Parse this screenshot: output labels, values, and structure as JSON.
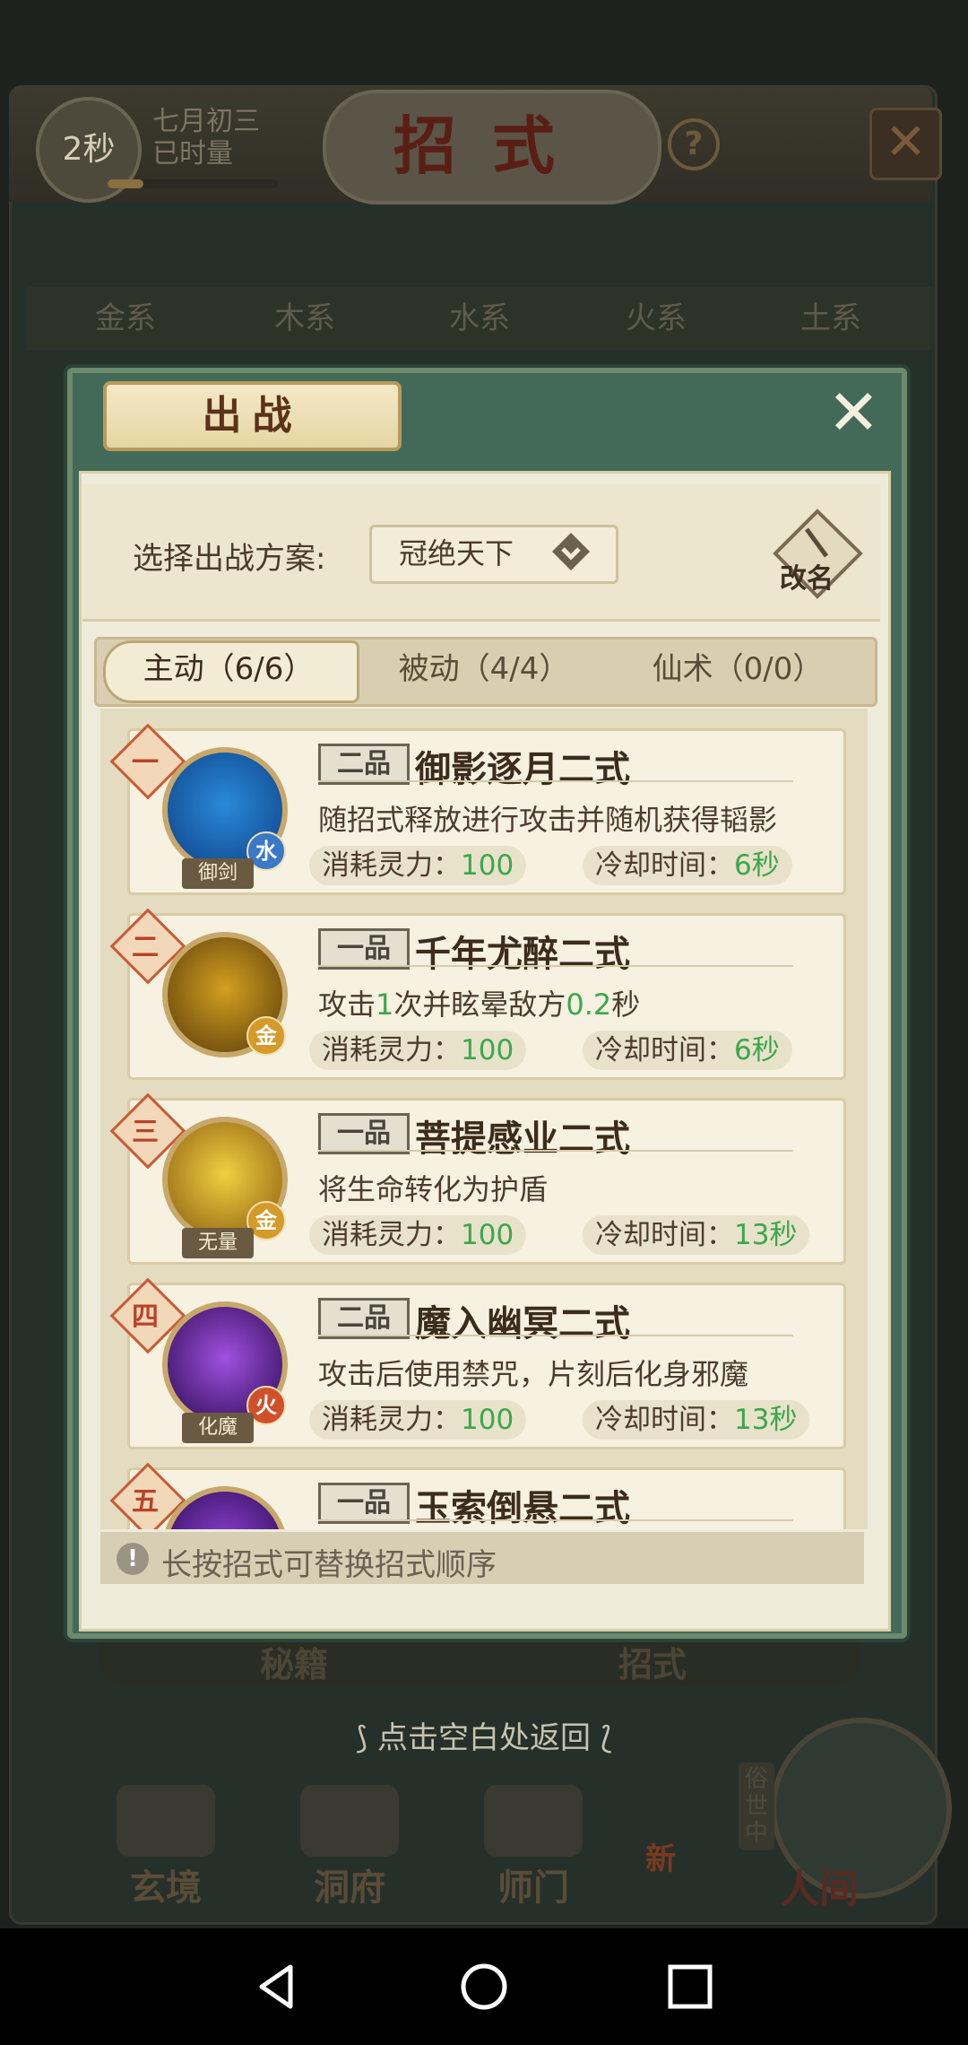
{
  "background": {
    "timer": "2秒",
    "date_line1": "七月初三",
    "date_line2": "已时量",
    "title": "招式",
    "help": "?",
    "tabs": [
      "金系",
      "木系",
      "水系",
      "火系",
      "土系"
    ],
    "bottom_tabs": [
      "秘籍",
      "招式"
    ],
    "return_hint": "点击空白处返回",
    "nav": [
      "玄境",
      "洞府",
      "师门"
    ],
    "new_badge": "新",
    "world_vertical": "俗世中",
    "world_label": "人间"
  },
  "modal": {
    "title": "出战",
    "plan_label": "选择出战方案:",
    "plan_value": "冠绝天下",
    "rename_label": "改名",
    "tabs": [
      {
        "label": "主动（6/6）",
        "active": true
      },
      {
        "label": "被动（4/4）",
        "active": false
      },
      {
        "label": "仙术（0/0）",
        "active": false
      }
    ],
    "skills": [
      {
        "num": "一",
        "grade": "二品",
        "name": "御影逐月二式",
        "desc_parts": [
          {
            "t": "随招式释放进行攻击并随机获得韬影",
            "hl": false
          }
        ],
        "cost_label": "消耗灵力：",
        "cost": "100",
        "cd_label": "冷却时间：",
        "cd": "6秒",
        "element": "水",
        "element_color": "#3a78c8",
        "school": "御剑",
        "icon_colors": [
          "#2a8ad8",
          "#0d3f86"
        ]
      },
      {
        "num": "二",
        "grade": "一品",
        "name": "千年尤醉二式",
        "desc_parts": [
          {
            "t": "攻击",
            "hl": false
          },
          {
            "t": "1",
            "hl": true
          },
          {
            "t": "次并眩晕敌方",
            "hl": false
          },
          {
            "t": "0.2",
            "hl": true
          },
          {
            "t": "秒",
            "hl": false
          }
        ],
        "cost_label": "消耗灵力：",
        "cost": "100",
        "cd_label": "冷却时间：",
        "cd": "6秒",
        "element": "金",
        "element_color": "#d49a2a",
        "school": "",
        "icon_colors": [
          "#d2a020",
          "#5a3a0a"
        ]
      },
      {
        "num": "三",
        "grade": "一品",
        "name": "菩提感业二式",
        "desc_parts": [
          {
            "t": "将生命转化为护盾",
            "hl": false
          }
        ],
        "cost_label": "消耗灵力：",
        "cost": "100",
        "cd_label": "冷却时间：",
        "cd": "13秒",
        "element": "金",
        "element_color": "#d49a2a",
        "school": "无量",
        "icon_colors": [
          "#f0d040",
          "#8a5a10"
        ]
      },
      {
        "num": "四",
        "grade": "二品",
        "name": "魔入幽冥二式",
        "desc_parts": [
          {
            "t": "攻击后使用禁咒，片刻后化身邪魔",
            "hl": false
          }
        ],
        "cost_label": "消耗灵力：",
        "cost": "100",
        "cd_label": "冷却时间：",
        "cd": "13秒",
        "element": "火",
        "element_color": "#d0502a",
        "school": "化魔",
        "icon_colors": [
          "#a050e0",
          "#2a0a50"
        ]
      },
      {
        "num": "五",
        "grade": "一品",
        "name": "玉索倒悬二式",
        "desc_parts": [],
        "cost_label": "",
        "cost": "",
        "cd_label": "",
        "cd": "",
        "element": "",
        "element_color": "#888888",
        "school": "",
        "icon_colors": [
          "#8a40d0",
          "#2a0a50"
        ]
      }
    ],
    "hint": "长按招式可替换招式顺序"
  }
}
